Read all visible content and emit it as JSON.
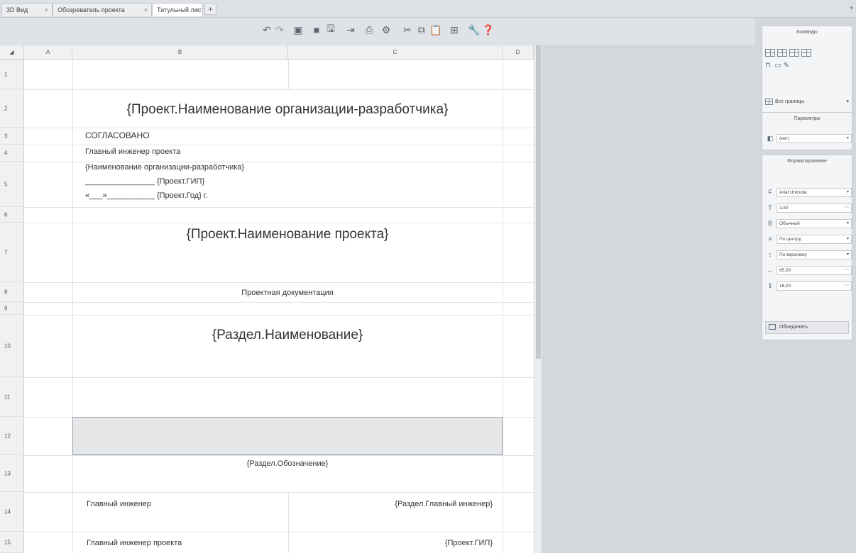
{
  "tabs": [
    {
      "label": "3D Вид",
      "active": false
    },
    {
      "label": "Обозреватель проекта",
      "active": false
    },
    {
      "label": "Титульный лист",
      "active": true
    }
  ],
  "tab_close_glyph": "×",
  "tab_add_glyph": "+",
  "toolbar_icons": [
    "undo-icon",
    "redo-icon",
    "copy-format-icon",
    "folder-icon",
    "save-icon",
    "export-icon",
    "print-icon",
    "settings-icon",
    "cut-icon",
    "copy-icon",
    "paste-icon",
    "table-icon",
    "wrench-icon",
    "help-icon"
  ],
  "columns": [
    "A",
    "B",
    "C",
    "D"
  ],
  "rows": [
    "1",
    "2",
    "3",
    "4",
    "5",
    "6",
    "7",
    "8",
    "9",
    "10",
    "11",
    "12",
    "13",
    "14",
    "15"
  ],
  "sheet": {
    "org_name": "{Проект.Наименование организации-разработчика}",
    "approved": "СОГЛАСОВАНО",
    "chief_engineer": "Главный инженер проекта",
    "org_name_small": "{Наименование организации-разработчика}",
    "gip_line": "________________ {Проект.ГИП}",
    "date_line": "«___»___________ {Проект.Год} г.",
    "project_name": "{Проект.Наименование проекта}",
    "project_doc": "Проектная документация",
    "section_name": "{Раздел.Наименование}",
    "section_code": "{Раздел.Обозначение}",
    "sign1_label": "Главный инженер",
    "sign1_value": "{Раздел.Главный инженер}",
    "sign2_label": "Главный инженер проекта",
    "sign2_value": "{Проект.ГИП}"
  },
  "panels": {
    "commands": {
      "title": "Команды",
      "borders_label": "Все границы"
    },
    "params": {
      "title": "Параметры",
      "value": "(нет)"
    },
    "format": {
      "title": "Форматирование",
      "font": "Arial Unicode",
      "size": "3,50",
      "style": "Обычный",
      "h_align": "По центру",
      "v_align": "По верхнему",
      "width": "85,00",
      "height": "16,00",
      "merge_label": "Объединить"
    }
  },
  "colors": {
    "accent": "#5a6a7a",
    "grey_cell": "#e5e7e9"
  }
}
